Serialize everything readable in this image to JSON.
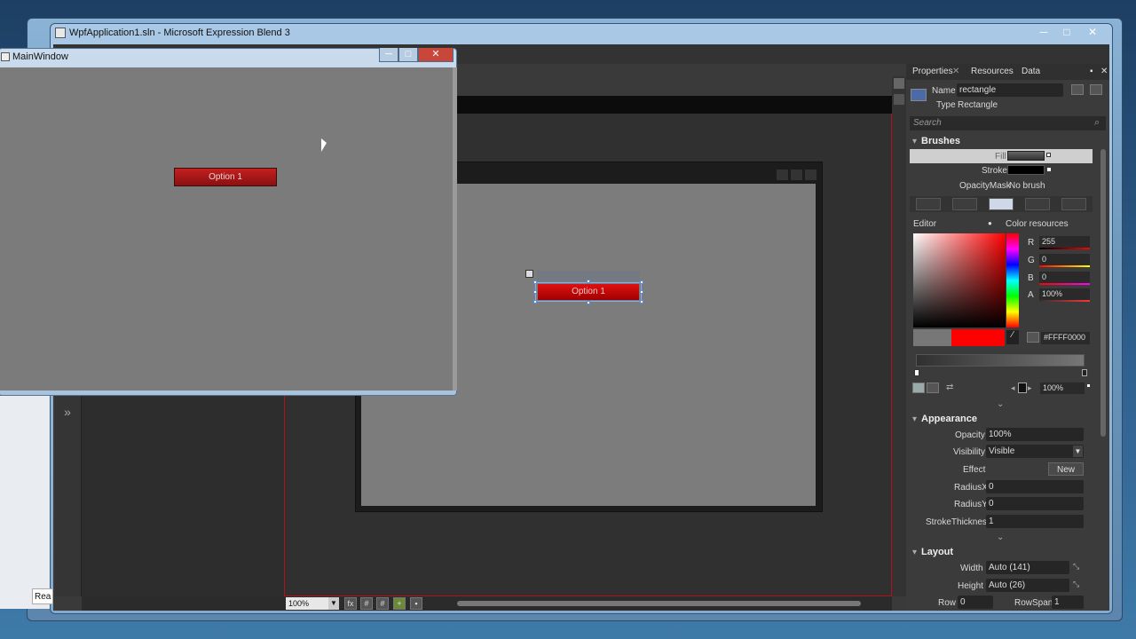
{
  "main_window": {
    "title": "WpfApplication1.sln - Microsoft Expression Blend 3",
    "min": "─",
    "max": "□",
    "close": "✕"
  },
  "app_window": {
    "title": "MainWindow",
    "option_label": "Option 1",
    "min": "─",
    "max": "□",
    "close": "✕"
  },
  "artboard": {
    "button_label": "Option 1",
    "zoom": "100%"
  },
  "left_peek": {
    "tab_label": "Rea"
  },
  "properties": {
    "tabs": [
      "Properties",
      "Resources",
      "Data"
    ],
    "name_label": "Name",
    "name_value": "rectangle",
    "type_label": "Type",
    "type_value": "Rectangle",
    "search_placeholder": "Search",
    "brushes": {
      "header": "Brushes",
      "fill_label": "Fill",
      "stroke_label": "Stroke",
      "opacity_mask_label": "OpacityMask",
      "opacity_mask_value": "No brush",
      "editor_label": "Editor",
      "color_resources_label": "Color resources",
      "r_label": "R",
      "r_value": "255",
      "g_label": "G",
      "g_value": "0",
      "b_label": "B",
      "b_value": "0",
      "a_label": "A",
      "a_value": "100%",
      "hex_value": "#FFFF0000",
      "stop_offset": "100%",
      "fill_color": "#ff0000"
    },
    "appearance": {
      "header": "Appearance",
      "opacity_label": "Opacity",
      "opacity_value": "100%",
      "visibility_label": "Visibility",
      "visibility_value": "Visible",
      "effect_label": "Effect",
      "effect_button": "New",
      "radiusx_label": "RadiusX",
      "radiusx_value": "0",
      "radiusy_label": "RadiusY",
      "radiusy_value": "0",
      "stroke_thickness_label": "StrokeThickness",
      "stroke_thickness_value": "1"
    },
    "layout": {
      "header": "Layout",
      "width_label": "Width",
      "width_value": "Auto (141)",
      "height_label": "Height",
      "height_value": "Auto (26)",
      "row_label": "Row",
      "row_value": "0",
      "rowspan_label": "RowSpan",
      "rowspan_value": "1"
    }
  }
}
